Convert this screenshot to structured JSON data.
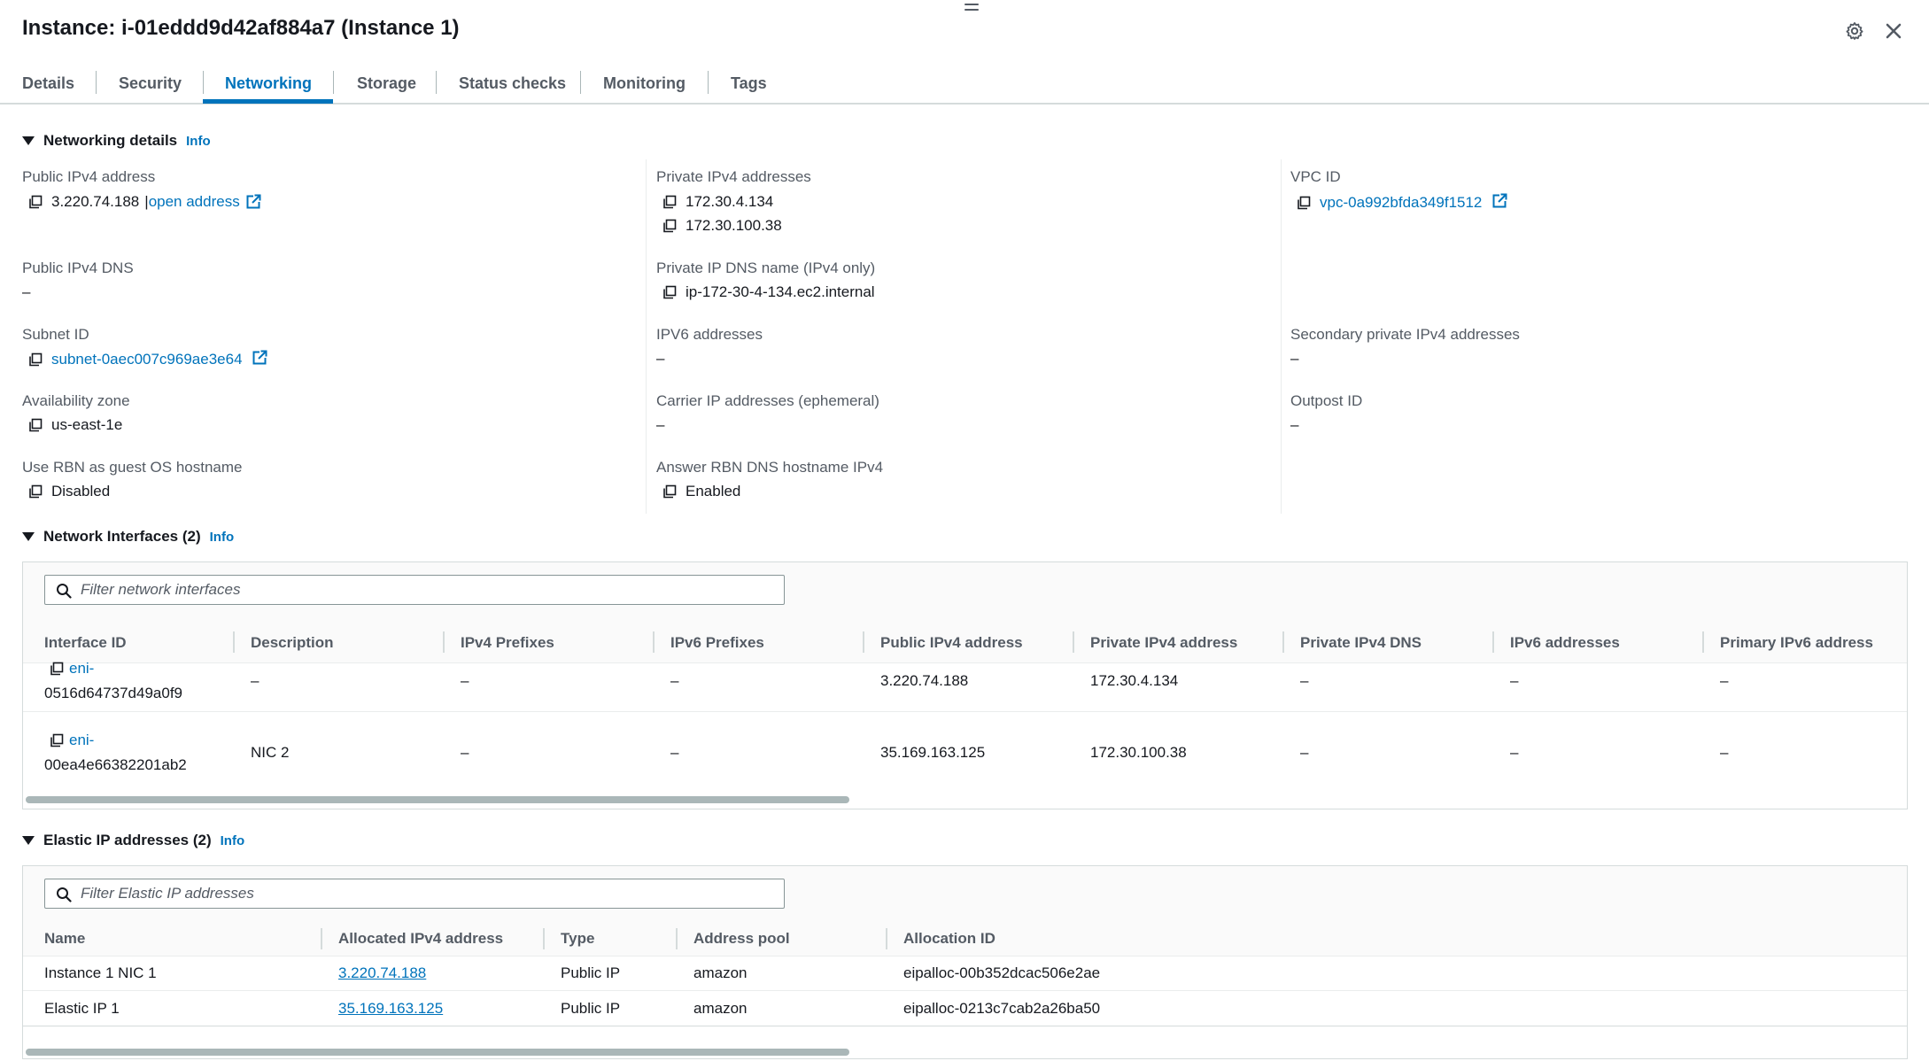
{
  "header": {
    "title": "Instance: i-01eddd9d42af884a7 (Instance 1)",
    "settings_icon": "gear-icon",
    "close_icon": "close-icon"
  },
  "tabs": [
    {
      "label": "Details"
    },
    {
      "label": "Security"
    },
    {
      "label": "Networking",
      "active": true
    },
    {
      "label": "Storage"
    },
    {
      "label": "Status checks"
    },
    {
      "label": "Monitoring"
    },
    {
      "label": "Tags"
    }
  ],
  "networking_details": {
    "title": "Networking details",
    "info": "Info",
    "public_ipv4": {
      "label": "Public IPv4 address",
      "value": "3.220.74.188",
      "sep": "|",
      "link": "open address"
    },
    "private_ipv4": {
      "label": "Private IPv4 addresses",
      "values": [
        "172.30.4.134",
        "172.30.100.38"
      ]
    },
    "vpc_id": {
      "label": "VPC ID",
      "value": "vpc-0a992bfda349f1512"
    },
    "public_dns": {
      "label": "Public IPv4 DNS",
      "value": "–"
    },
    "private_dns": {
      "label": "Private IP DNS name (IPv4 only)",
      "value": "ip-172-30-4-134.ec2.internal"
    },
    "subnet_id": {
      "label": "Subnet ID",
      "value": "subnet-0aec007c969ae3e64"
    },
    "ipv6": {
      "label": "IPV6 addresses",
      "value": "–"
    },
    "secondary_private": {
      "label": "Secondary private IPv4 addresses",
      "value": "–"
    },
    "az": {
      "label": "Availability zone",
      "value": "us-east-1e"
    },
    "carrier_ip": {
      "label": "Carrier IP addresses (ephemeral)",
      "value": "–"
    },
    "outpost": {
      "label": "Outpost ID",
      "value": "–"
    },
    "rbn_hostname": {
      "label": "Use RBN as guest OS hostname",
      "value": "Disabled"
    },
    "rbn_dns": {
      "label": "Answer RBN DNS hostname IPv4",
      "value": "Enabled"
    }
  },
  "network_interfaces": {
    "title": "Network Interfaces (2)",
    "info": "Info",
    "filter_placeholder": "Filter network interfaces",
    "columns": [
      "Interface ID",
      "Description",
      "IPv4 Prefixes",
      "IPv6 Prefixes",
      "Public IPv4 address",
      "Private IPv4 address",
      "Private IPv4 DNS",
      "IPv6 addresses",
      "Primary IPv6 address"
    ],
    "rows": [
      {
        "id_line1": "eni-",
        "id_line2": "0516d64737d49a0f9",
        "description": "–",
        "ipv4_prefixes": "–",
        "ipv6_prefixes": "–",
        "public_ipv4": "3.220.74.188",
        "private_ipv4": "172.30.4.134",
        "private_dns": "–",
        "ipv6": "–",
        "primary_ipv6": "–"
      },
      {
        "id_line1": "eni-",
        "id_line2": "00ea4e66382201ab2",
        "description": "NIC 2",
        "ipv4_prefixes": "–",
        "ipv6_prefixes": "–",
        "public_ipv4": "35.169.163.125",
        "private_ipv4": "172.30.100.38",
        "private_dns": "–",
        "ipv6": "–",
        "primary_ipv6": "–"
      }
    ]
  },
  "elastic_ips": {
    "title": "Elastic IP addresses (2)",
    "info": "Info",
    "filter_placeholder": "Filter Elastic IP addresses",
    "columns": [
      "Name",
      "Allocated IPv4 address",
      "Type",
      "Address pool",
      "Allocation ID"
    ],
    "rows": [
      {
        "name": "Instance 1 NIC 1",
        "ip": "3.220.74.188",
        "type": "Public IP",
        "pool": "amazon",
        "allocation_id": "eipalloc-00b352dcac506e2ae"
      },
      {
        "name": "Elastic IP 1",
        "ip": "35.169.163.125",
        "type": "Public IP",
        "pool": "amazon",
        "allocation_id": "eipalloc-0213c7cab2a26ba50"
      }
    ]
  }
}
